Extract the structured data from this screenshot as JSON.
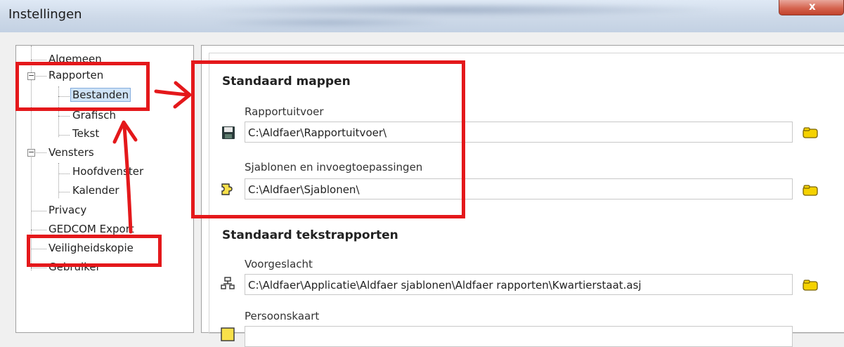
{
  "window": {
    "title": "Instellingen",
    "close_glyph": "x"
  },
  "tree": {
    "items": [
      {
        "label": "Algemeen",
        "level": 0
      },
      {
        "label": "Rapporten",
        "level": 0,
        "expander": "−"
      },
      {
        "label": "Bestanden",
        "level": 1,
        "selected": true
      },
      {
        "label": "Grafisch",
        "level": 1
      },
      {
        "label": "Tekst",
        "level": 1
      },
      {
        "label": "Vensters",
        "level": 0,
        "expander": "−"
      },
      {
        "label": "Hoofdvenster",
        "level": 1
      },
      {
        "label": "Kalender",
        "level": 1
      },
      {
        "label": "Privacy",
        "level": 0
      },
      {
        "label": "GEDCOM Export",
        "level": 0
      },
      {
        "label": "Veiligheidskopie",
        "level": 0
      },
      {
        "label": "Gebruiker",
        "level": 0
      }
    ]
  },
  "content": {
    "section1": {
      "title": "Standaard mappen",
      "fields": [
        {
          "label": "Rapportuitvoer",
          "value": "C:\\Aldfaer\\Rapportuitvoer\\",
          "icon": "floppy-disk-icon"
        },
        {
          "label": "Sjablonen en invoegtoepassingen",
          "value": "C:\\Aldfaer\\Sjablonen\\",
          "icon": "puzzle-icon"
        }
      ]
    },
    "section2": {
      "title": "Standaard tekstrapporten",
      "fields": [
        {
          "label": "Voorgeslacht",
          "value": "C:\\Aldfaer\\Applicatie\\Aldfaer sjablonen\\Aldfaer rapporten\\Kwartierstaat.asj",
          "icon": "pedigree-tree-icon"
        },
        {
          "label": "Persoonskaart",
          "value": "",
          "icon": "person-card-icon"
        }
      ]
    }
  },
  "colors": {
    "annotation_red": "#e4181b",
    "folder_yellow": "#f5d200",
    "selection_blue": "#cfe3f7"
  }
}
